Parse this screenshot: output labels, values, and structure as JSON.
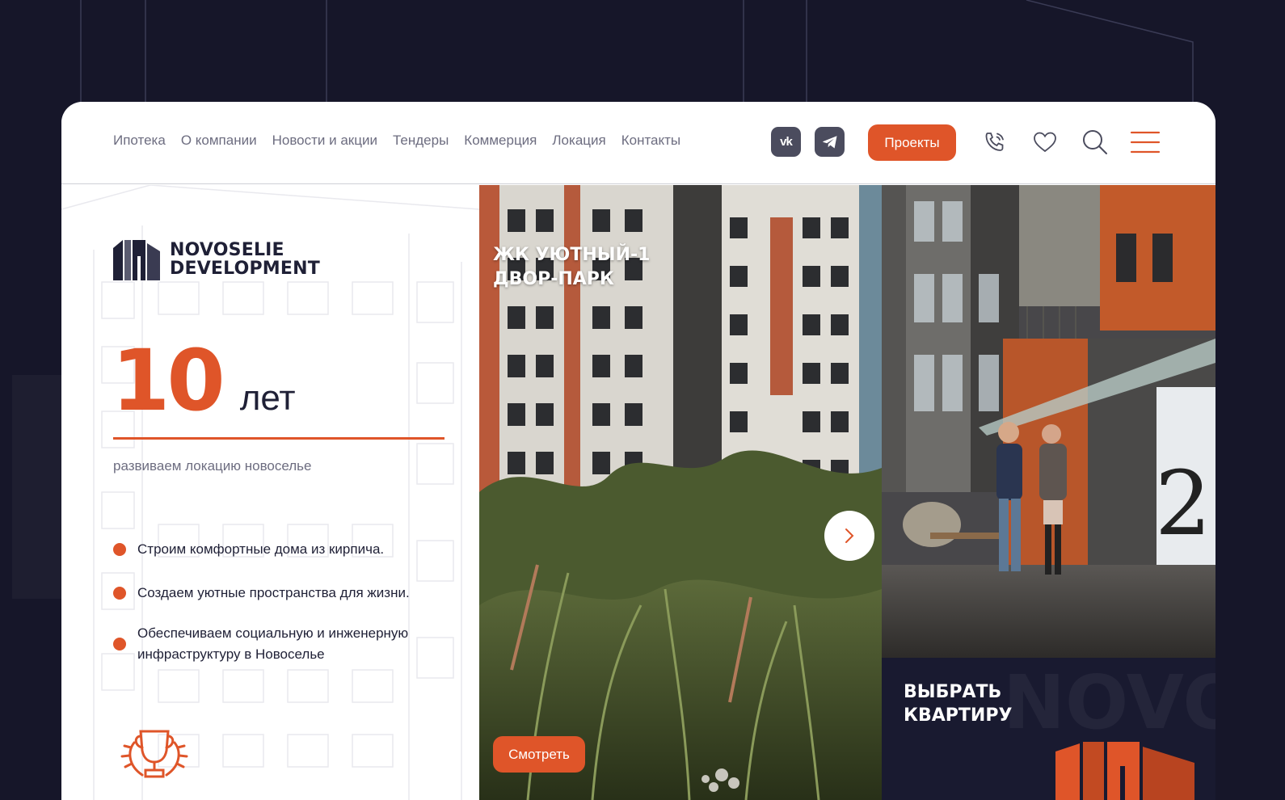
{
  "header": {
    "nav": [
      {
        "label": "Ипотека"
      },
      {
        "label": "О компании"
      },
      {
        "label": "Новости и акции"
      },
      {
        "label": "Тендеры"
      },
      {
        "label": "Коммерция"
      },
      {
        "label": "Локация"
      },
      {
        "label": "Контакты"
      }
    ],
    "social": {
      "vk_label": "vk",
      "vk_icon": "vk-icon",
      "tg_icon": "telegram-icon"
    },
    "projects_button": "Проекты",
    "icons": [
      "phone-icon",
      "heart-icon",
      "search-icon",
      "menu-icon"
    ]
  },
  "brand": {
    "line1": "NOVOSELIE",
    "line2": "DEVELOPMENT"
  },
  "hero": {
    "years_number": "10",
    "years_unit": "лет",
    "tagline": "развиваем локацию новоселье",
    "bullets": [
      {
        "lines": [
          "Строим комфортные дома из кирпича."
        ]
      },
      {
        "lines": [
          "Создаем уютные пространства для жизни."
        ]
      },
      {
        "lines": [
          "Обеспечиваем социальную и инженерную",
          "инфраструктуру в Новоселье"
        ]
      }
    ]
  },
  "project_card": {
    "title_line1": "ЖК УЮТНЫЙ-1",
    "title_line2": "ДВОР-ПАРК",
    "watch_button": "Смотреть"
  },
  "choose_flat": {
    "line1": "ВЫБРАТЬ",
    "line2": "КВАРТИРУ"
  },
  "colors": {
    "accent": "#df5529",
    "dark": "#161629",
    "text": "#1f2036",
    "muted": "#6d6d80"
  }
}
